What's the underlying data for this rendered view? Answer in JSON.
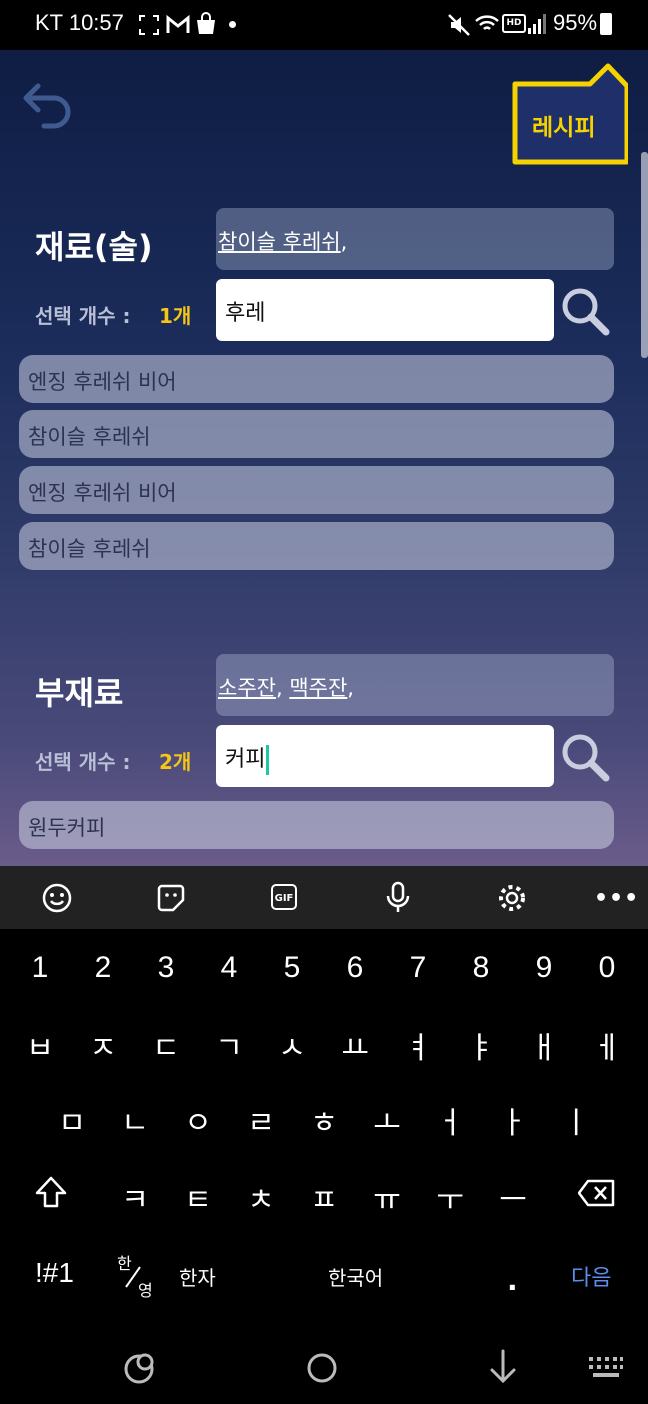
{
  "status_bar": {
    "carrier_time": "KT 10:57",
    "battery": "95%"
  },
  "header": {
    "recipe_label": "레시피"
  },
  "ingredients": {
    "title": "재료(술)",
    "count_label": "선택 개수 :",
    "count_value": "1개",
    "selected": [
      "참이슬 후레쉬"
    ],
    "search_value": "후레",
    "results": [
      "엔징 후레쉬 비어",
      "참이슬 후레쉬",
      "엔징 후레쉬 비어",
      "참이슬 후레쉬"
    ]
  },
  "sub_ingredients": {
    "title": "부재료",
    "count_label": "선택 개수 :",
    "count_value": "2개",
    "selected": [
      "소주잔",
      "맥주잔"
    ],
    "search_value": "커피",
    "results": [
      "원두커피"
    ]
  },
  "keyboard": {
    "number_row": [
      "1",
      "2",
      "3",
      "4",
      "5",
      "6",
      "7",
      "8",
      "9",
      "0"
    ],
    "row1": [
      "ㅂ",
      "ㅈ",
      "ㄷ",
      "ㄱ",
      "ㅅ",
      "ㅛ",
      "ㅕ",
      "ㅑ",
      "ㅐ",
      "ㅔ"
    ],
    "row2": [
      "ㅁ",
      "ㄴ",
      "ㅇ",
      "ㄹ",
      "ㅎ",
      "ㅗ",
      "ㅓ",
      "ㅏ",
      "ㅣ"
    ],
    "row3": [
      "ㅋ",
      "ㅌ",
      "ㅊ",
      "ㅍ",
      "ㅠ",
      "ㅜ",
      "ㅡ"
    ],
    "symbols_key": "!#1",
    "lang_top": "한",
    "lang_bottom": "영",
    "hanja_key": "한자",
    "space_label": "한국어",
    "period_key": ".",
    "next_key": "다음",
    "accent_color": "#5b8def"
  },
  "icons": {
    "back": "back-arrow-icon",
    "search": "search-icon",
    "emoji": "emoji-icon",
    "sticker": "sticker-icon",
    "gif": "GIF",
    "mic": "mic-icon",
    "settings": "gear-icon",
    "more": "more-icon",
    "shift": "shift-icon",
    "backspace": "backspace-icon"
  }
}
